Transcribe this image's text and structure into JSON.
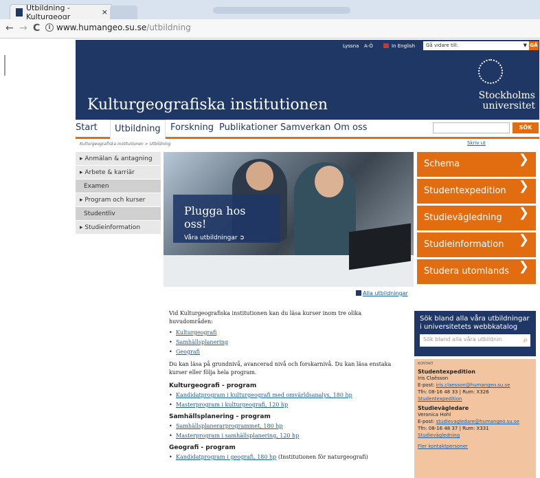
{
  "browser": {
    "tab_title": "Utbildning - Kulturgeogr",
    "tab_close": "×",
    "url_host": "www.humangeo.su.se",
    "url_path": "/utbildning",
    "back": "←",
    "forward": "→",
    "reload": "C",
    "info": "i"
  },
  "header": {
    "links": [
      "Lyssna",
      "A-Ö",
      "In English"
    ],
    "goto_placeholder": "Gå vidare till:",
    "goto_arrow": "▼",
    "go_label": "GÅ",
    "site_title": "Kulturgeografiska institutionen",
    "university_line1": "Stockholms",
    "university_line2": "universitet"
  },
  "mainnav": {
    "items": [
      "Start",
      "Utbildning",
      "Forskning",
      "Publikationer",
      "Samverkan",
      "Om oss"
    ],
    "search_button": "SÖK"
  },
  "breadcrumb": "Kulturgeografiska institutionen > Utbildning",
  "print_label": "Skriv ut",
  "sidenav": {
    "items": [
      "▸ Anmälan & antagning",
      "▸ Arbete & karriär",
      "Examen",
      "▸ Program och kurser",
      "Studentliv",
      "▸ Studieinformation"
    ]
  },
  "hero": {
    "title": "Plugga hos oss!",
    "link": "Våra utbildningar ➲"
  },
  "alla_link": "Alla utbildningar",
  "orange_buttons": [
    "Schema",
    "Studentexpedition",
    "Studievägledning",
    "Studieinformation",
    "Studera utomlands"
  ],
  "chevron": "❯",
  "content": {
    "intro": "Vid Kulturgeografiska institutionen kan du läsa kurser inom tre olika huvudområden:",
    "areas": [
      "Kulturgeografi",
      "Samhällsplanering",
      "Geografi"
    ],
    "levels_text": "Du kan läsa på grundnivå, avancerad nivå och forskarnivå. Du kan läsa enstaka kurser eller följa hela program.",
    "h1": "Kulturgeografi - program",
    "list1": [
      "Kandidatprogram i kulturgeografi med omvärldsanalys, 180 hp",
      "Masterprogram i kulturgeografi, 120 hp"
    ],
    "h2": "Samhällsplanering - program",
    "list2": [
      "Samhällsplanerarprogrammet, 180 hp",
      "Masterprogram i samhällsplanering, 120 hp"
    ],
    "h3": "Geografi - program",
    "list3_link": "Kandidatprogram i geografi, 180 hp",
    "list3_suffix": " (Institutionen för naturgeografi)"
  },
  "search_box": {
    "title": "Sök bland alla våra utbildningar i universitetets webbkatalog",
    "placeholder": "Sök bland alla våra utbildnin",
    "icon": "⌕"
  },
  "contact": {
    "label": "KONTAKT",
    "name1_title": "Studentexpedition",
    "name1": "Iris Claësson",
    "email1_prefix": "E-post: ",
    "email1": "iris.claesson@humangeo.su.se",
    "phone1": "Tfn: 08-16 48 33 | Rum: X326",
    "link1": "Studentexpedition",
    "name2_title": "Studievägledare",
    "name2": "Veronica Hohl",
    "email2_prefix": "E-post: ",
    "email2": "studievagledare@humangeo.su.se",
    "phone2": "Tfn: 08-16 48 37 | Rum: X331",
    "link2": "Studievägledning",
    "more": "Fler kontaktpersoner"
  },
  "colors": {
    "navy": "#1e3765",
    "orange": "#e26c10",
    "contact_bg": "#f2c5a0"
  }
}
